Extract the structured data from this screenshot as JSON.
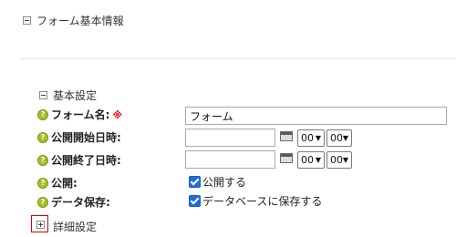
{
  "form_info": {
    "title": "フォーム基本情報",
    "toggle_icon": "collapse-icon"
  },
  "basic_settings": {
    "title": "基本設定",
    "toggle_icon": "collapse-icon",
    "help_icon_glyph": "?",
    "required_mark": "※",
    "form_name": {
      "label": "フォーム名:",
      "value": "フォーム"
    },
    "start_datetime": {
      "label": "公開開始日時:",
      "date_value": "",
      "hour": "00",
      "minute": "00"
    },
    "end_datetime": {
      "label": "公開終了日時:",
      "date_value": "",
      "hour": "00",
      "minute": "00"
    },
    "publish": {
      "label": "公開:",
      "checkbox_label": "公開する",
      "checked": true
    },
    "data_save": {
      "label": "データ保存:",
      "checkbox_label": "データベースに保存する",
      "checked": true
    },
    "select_arrow": "▼"
  },
  "advanced_settings": {
    "title": "詳細設定",
    "toggle_icon": "expand-icon",
    "highlight_color": "#e00000"
  },
  "colors": {
    "help_icon": "#a8bf2a",
    "checkbox": "#1f6fd6",
    "required": "#e00000"
  }
}
